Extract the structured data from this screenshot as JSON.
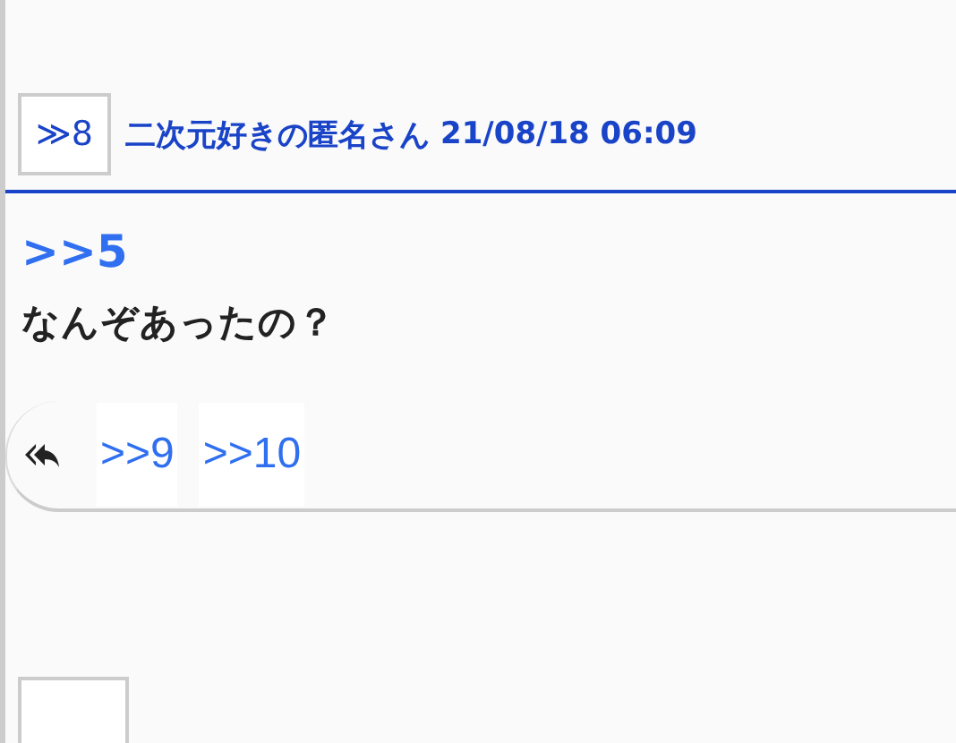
{
  "post": {
    "number": "≫8",
    "author": "二次元好きの匿名さん",
    "date": "21/08/18 06:09",
    "anchor": ">>5",
    "body": "なんぞあったの？",
    "replies": [
      ">>9",
      ">>10"
    ]
  }
}
